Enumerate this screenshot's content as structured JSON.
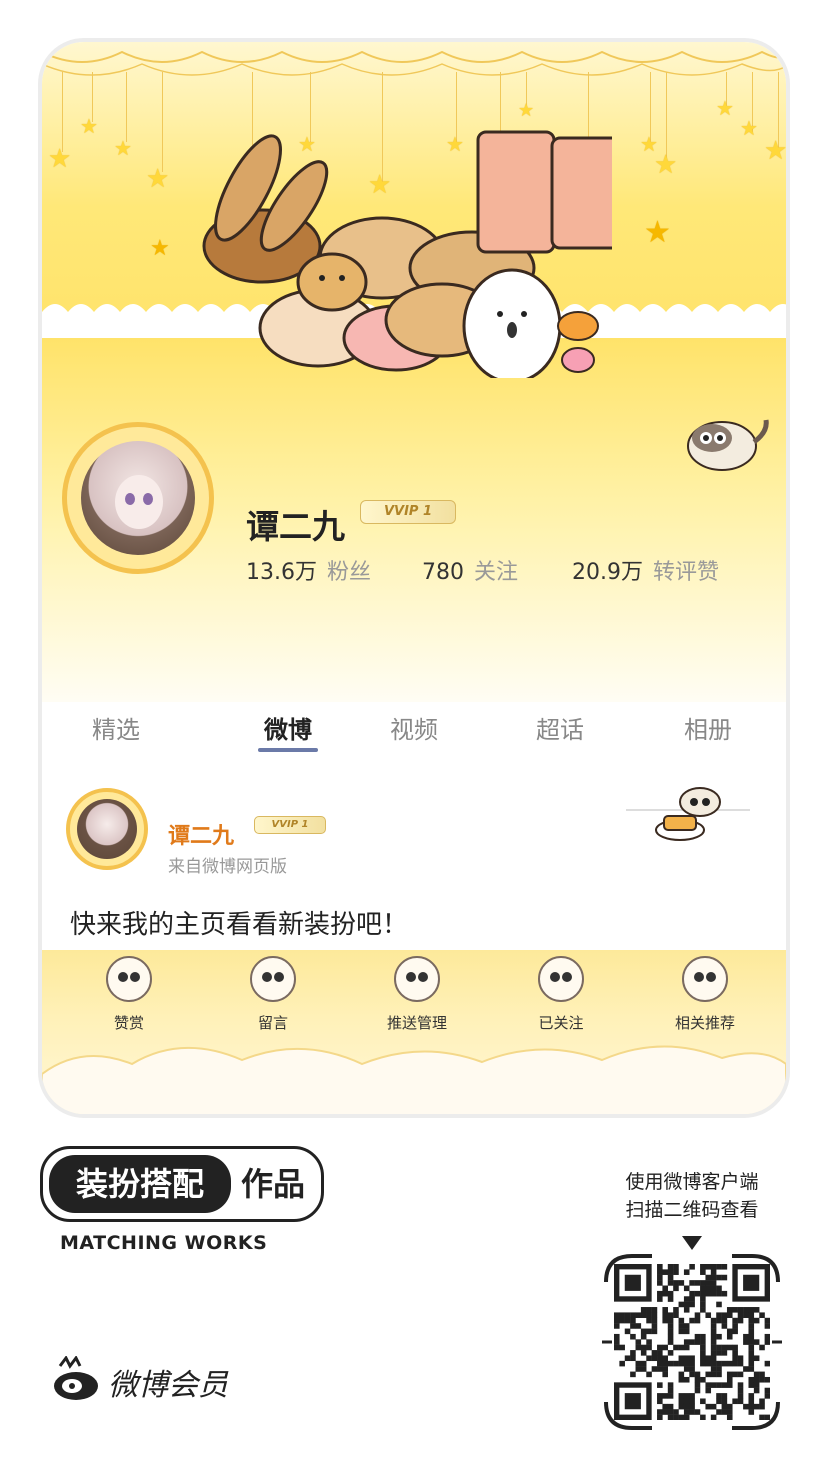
{
  "profile": {
    "name": "谭二九",
    "vip_badge": "VVIP 1",
    "stats": [
      {
        "value": "13.6万",
        "label": "粉丝"
      },
      {
        "value": "780",
        "label": "关注"
      },
      {
        "value": "20.9万",
        "label": "转评赞"
      }
    ]
  },
  "tabs": [
    {
      "label": "精选",
      "active": false
    },
    {
      "label": "微博",
      "active": true
    },
    {
      "label": "视频",
      "active": false
    },
    {
      "label": "超话",
      "active": false
    },
    {
      "label": "相册",
      "active": false
    }
  ],
  "post": {
    "author": "谭二九",
    "vip_badge": "VVIP 1",
    "source": "来自微博网页版",
    "text": "快来我的主页看看新装扮吧！"
  },
  "actions": [
    {
      "label": "赞赏"
    },
    {
      "label": "留言"
    },
    {
      "label": "推送管理"
    },
    {
      "label": "已关注"
    },
    {
      "label": "相关推荐"
    }
  ],
  "footer": {
    "badge_left": "装扮搭配",
    "badge_right": "作品",
    "subtitle": "MATCHING WORKS",
    "brand": "微博会员",
    "qr_caption_line1": "使用微博客户端",
    "qr_caption_line2": "扫描二维码查看"
  },
  "colors": {
    "banner_yellow": "#ffe36a",
    "accent_orange": "#e07a1a",
    "vip_gold": "#b08428"
  }
}
